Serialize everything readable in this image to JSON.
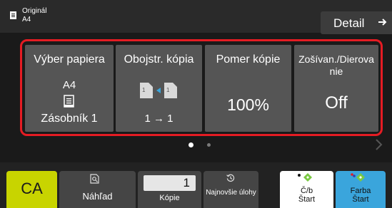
{
  "header": {
    "original_label": "Originál",
    "original_size": "A4",
    "detail_label": "Detail"
  },
  "tiles": {
    "paper": {
      "title": "Výber papiera",
      "size": "A4",
      "tray": "Zásobník 1"
    },
    "duplex": {
      "title": "Obojstr. kópia",
      "mode": "1 → 1"
    },
    "ratio": {
      "title": "Pomer kópie",
      "value": "100%"
    },
    "staple": {
      "title": "Zošívan./Dierova nie",
      "value": "Off"
    }
  },
  "pager": {
    "pages": 2,
    "current": 1
  },
  "bottom": {
    "ca_label": "CA",
    "preview_label": "Náhľad",
    "copies_value": "1",
    "copies_label": "Kópie",
    "recent_label": "Najnovšie úlohy",
    "bw_start_label_1": "Č/b",
    "bw_start_label_2": "Štart",
    "color_start_label_1": "Farba",
    "color_start_label_2": "Štart"
  },
  "colors": {
    "highlight_border": "#e51c23",
    "ca_button": "#c8d400",
    "color_start": "#3aa5dc",
    "start_diamond": "#7ac943"
  },
  "icons": [
    "document-icon",
    "arrow-right-icon",
    "paper-tray-icon",
    "duplex-icon",
    "chevron-right-icon",
    "preview-icon",
    "history-icon",
    "bw-start-icon",
    "color-start-icon"
  ]
}
